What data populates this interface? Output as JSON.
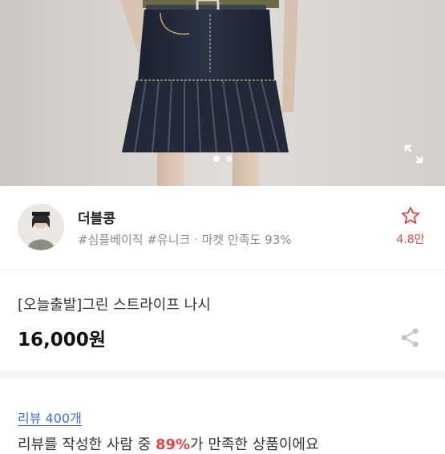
{
  "hero": {
    "slide_count": 2,
    "active_slide": 1,
    "expand_icon": "expand-icon"
  },
  "seller": {
    "avatar_icon": "avatar",
    "name": "더블콩",
    "tags": "#심플베이직 #유니크 · 마켓 만족도 93%",
    "fav_icon": "star-outline-icon",
    "fav_count": "4.8만"
  },
  "product": {
    "title": "[오늘출발]그린 스트라이프 나시",
    "price": "16,000원",
    "share_icon": "share-icon"
  },
  "review": {
    "link": "리뷰 400개",
    "summary_prefix": "리뷰를 작성한 사람 중 ",
    "summary_highlight": "89%",
    "summary_suffix": "가 만족한 상품이에요"
  },
  "colors": {
    "accent_red": "#e64545",
    "link_blue": "#3c6fd8",
    "muted_text": "#8a8a8a"
  }
}
